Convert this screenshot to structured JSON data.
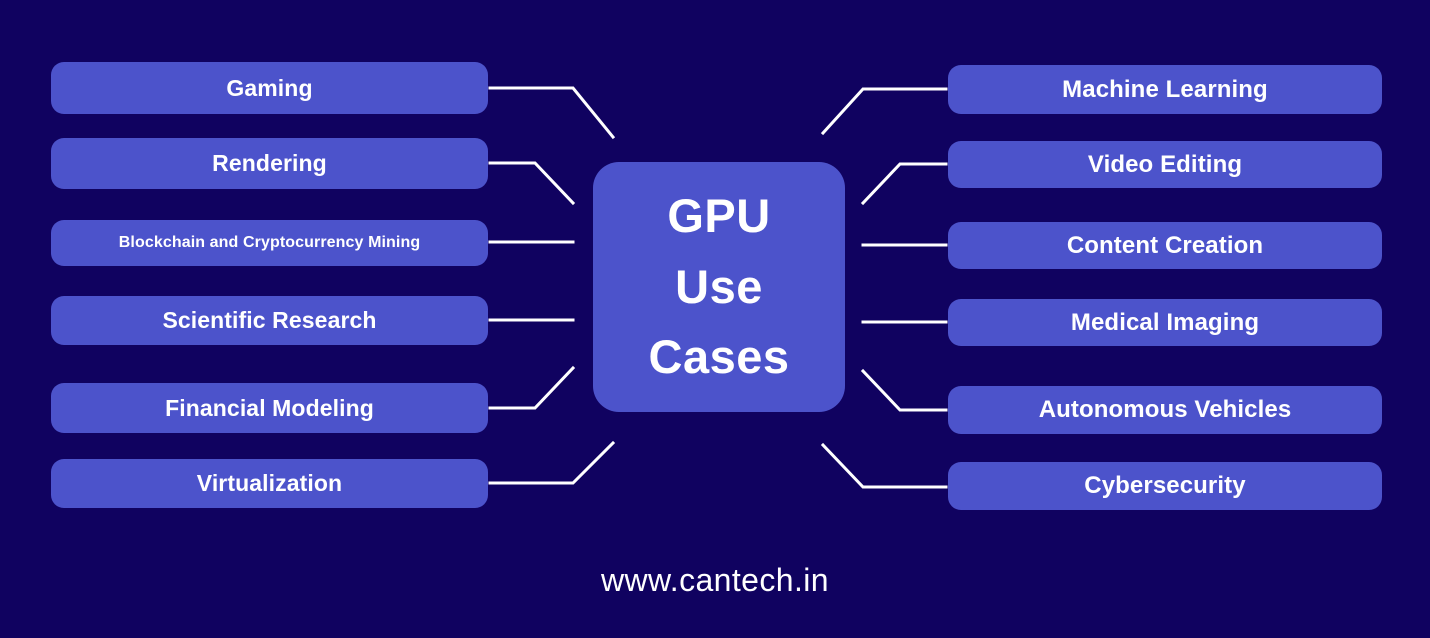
{
  "page": {
    "background_color": "#100260",
    "node_color": "#4c53cb",
    "text_color": "#ffffff",
    "connector_color": "#ffffff"
  },
  "center": {
    "name": "GPU Use Cases",
    "lines": [
      "GPU",
      "Use",
      "Cases"
    ]
  },
  "left_nodes": [
    {
      "label": "Gaming"
    },
    {
      "label": "Rendering"
    },
    {
      "label": "Blockchain and Cryptocurrency Mining"
    },
    {
      "label": "Scientific Research"
    },
    {
      "label": "Financial Modeling"
    },
    {
      "label": "Virtualization"
    }
  ],
  "right_nodes": [
    {
      "label": "Machine Learning"
    },
    {
      "label": "Video Editing"
    },
    {
      "label": "Content Creation"
    },
    {
      "label": "Medical Imaging"
    },
    {
      "label": "Autonomous Vehicles"
    },
    {
      "label": "Cybersecurity"
    }
  ],
  "footer": {
    "url": "www.cantech.in"
  },
  "chart_data": {
    "type": "diagram",
    "diagram_kind": "mind-map",
    "title": "GPU Use Cases",
    "center_node": "GPU Use Cases",
    "branches": [
      {
        "side": "left",
        "label": "Gaming"
      },
      {
        "side": "left",
        "label": "Rendering"
      },
      {
        "side": "left",
        "label": "Blockchain and Cryptocurrency Mining"
      },
      {
        "side": "left",
        "label": "Scientific Research"
      },
      {
        "side": "left",
        "label": "Financial Modeling"
      },
      {
        "side": "left",
        "label": "Virtualization"
      },
      {
        "side": "right",
        "label": "Machine Learning"
      },
      {
        "side": "right",
        "label": "Video Editing"
      },
      {
        "side": "right",
        "label": "Content Creation"
      },
      {
        "side": "right",
        "label": "Medical Imaging"
      },
      {
        "side": "right",
        "label": "Autonomous Vehicles"
      },
      {
        "side": "right",
        "label": "Cybersecurity"
      }
    ],
    "footer": "www.cantech.in"
  }
}
